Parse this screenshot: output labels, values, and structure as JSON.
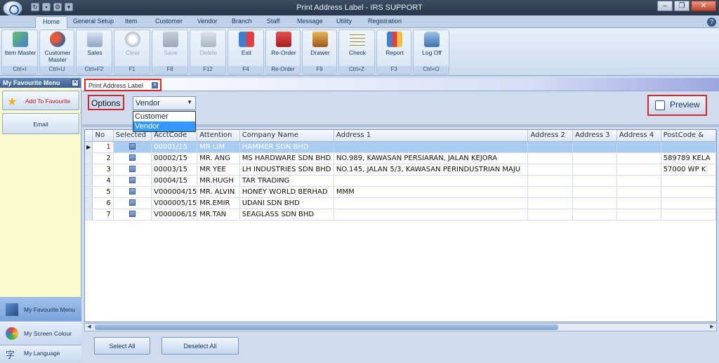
{
  "window": {
    "title": "Print Address Label - IRS SUPPORT"
  },
  "menu_tabs": [
    "Home",
    "General Setup",
    "Item",
    "Customer",
    "Vendor",
    "Branch",
    "Staff",
    "Message",
    "Utility",
    "Registration"
  ],
  "ribbon": {
    "buttons": [
      {
        "label": "Item Master",
        "shortcut": "Ctrl+I",
        "icon": "item-master-icon"
      },
      {
        "label": "Customer Master",
        "shortcut": "Ctrl+U",
        "icon": "customer-master-icon"
      },
      {
        "label": "Sales",
        "shortcut": "Ctrl+F2",
        "icon": "sales-cart-icon"
      },
      {
        "label": "Clear",
        "shortcut": "F1",
        "icon": "clear-icon"
      },
      {
        "label": "Save",
        "shortcut": "F8",
        "icon": "save-disk-icon"
      },
      {
        "label": "Delete",
        "shortcut": "F12",
        "icon": "trash-icon"
      },
      {
        "label": "Exit",
        "shortcut": "F4",
        "icon": "exit-door-icon"
      },
      {
        "label": "Re-Order",
        "shortcut": "Re-Order",
        "icon": "reorder-basket-icon"
      },
      {
        "label": "Drawer",
        "shortcut": "F9",
        "icon": "drawer-icon"
      },
      {
        "label": "Check",
        "shortcut": "Ctrl+Z",
        "icon": "checklist-icon"
      },
      {
        "label": "Report",
        "shortcut": "F3",
        "icon": "report-chart-icon"
      },
      {
        "label": "Log Off",
        "shortcut": "Ctrl+O",
        "icon": "padlock-icon"
      }
    ]
  },
  "sidebar": {
    "header": "My Favourite Menu",
    "add_to_favourite": "Add To Favourite",
    "email": "Email",
    "panes": [
      "My Favourite Menu",
      "My Screen Colour",
      "My Language"
    ]
  },
  "doc_tab": {
    "label": "Print Address Label"
  },
  "options": {
    "label": "Options",
    "selected": "Vendor",
    "items": [
      "Customer",
      "Vendor"
    ]
  },
  "preview_label": "Preview",
  "grid": {
    "columns": [
      "No",
      "Selected",
      "AcctCode",
      "Attention",
      "Company Name",
      "Address 1",
      "Address 2",
      "Address 3",
      "Address 4",
      "PostCode &"
    ],
    "rows": [
      [
        "1",
        "",
        "00001/15",
        "MR LIM",
        "HAMMER SDN BHD",
        "",
        "",
        "",
        "",
        ""
      ],
      [
        "2",
        "",
        "00002/15",
        "MR. ANG",
        "MS HARDWARE SDN BHD",
        "NO.989, KAWASAN PERSIARAN, JALAN KEJORA",
        "",
        "",
        "",
        "589789 KELA"
      ],
      [
        "3",
        "",
        "00003/15",
        "MR YEE",
        "LH INDUSTRIES SDN BHD",
        "NO.145, JALAN 5/3, KAWASAN PERINDUSTRIAN MAJU",
        "",
        "",
        "",
        "57000 WP K"
      ],
      [
        "4",
        "",
        "00004/15",
        "MR.HUGH",
        "TAR TRADING",
        "",
        "",
        "",
        "",
        ""
      ],
      [
        "5",
        "",
        "V000004/15",
        "MR. ALVIN",
        "HONEY WORLD BERHAD",
        "MMM",
        "",
        "",
        "",
        ""
      ],
      [
        "6",
        "",
        "V000005/15",
        "MR.EMIR",
        "UDANI SDN BHD",
        "",
        "",
        "",
        "",
        ""
      ],
      [
        "7",
        "",
        "V000006/15",
        "MR.TAN",
        "SEAGLASS SDN BHD",
        "",
        "",
        "",
        "",
        ""
      ]
    ]
  },
  "actions": {
    "select_all": "Select All",
    "deselect_all": "Deselect All"
  }
}
